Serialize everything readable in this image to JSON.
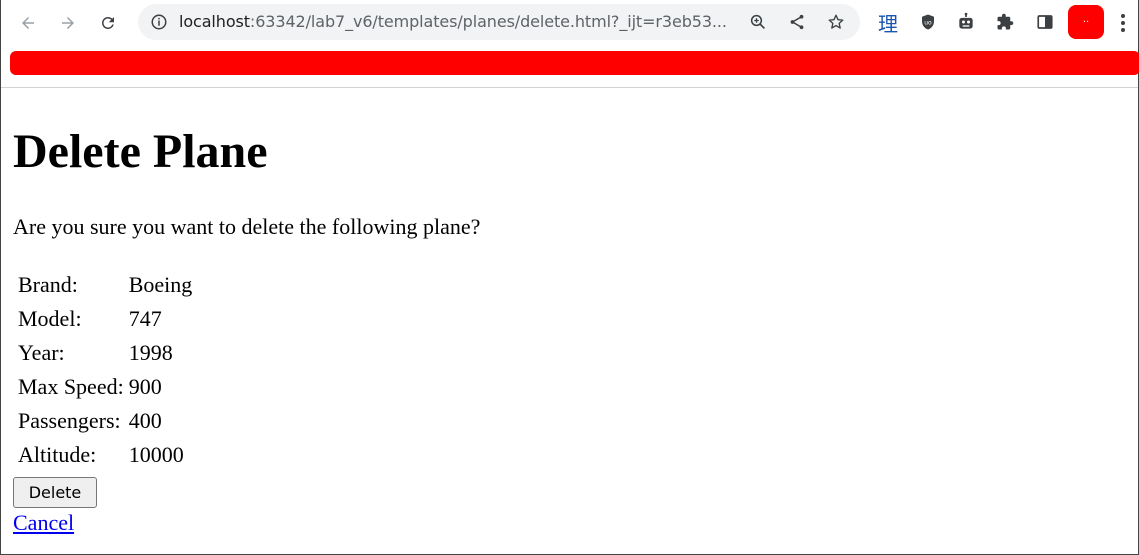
{
  "browser": {
    "url_host": "localhost",
    "url_rest": ":63342/lab7_v6/templates/planes/delete.html?_ijt=r3eb53...",
    "extension_glyph": "理",
    "profile_glyph": "··"
  },
  "page": {
    "title": "Delete Plane",
    "question": "Are you sure you want to delete the following plane?",
    "fields": [
      {
        "label": "Brand:",
        "value": "Boeing"
      },
      {
        "label": "Model:",
        "value": "747"
      },
      {
        "label": "Year:",
        "value": "1998"
      },
      {
        "label": "Max Speed:",
        "value": "900"
      },
      {
        "label": "Passengers:",
        "value": "400"
      },
      {
        "label": "Altitude:",
        "value": "10000"
      }
    ],
    "delete_label": "Delete",
    "cancel_label": "Cancel"
  },
  "colors": {
    "banner": "#ff0000",
    "link": "#0000ee"
  }
}
